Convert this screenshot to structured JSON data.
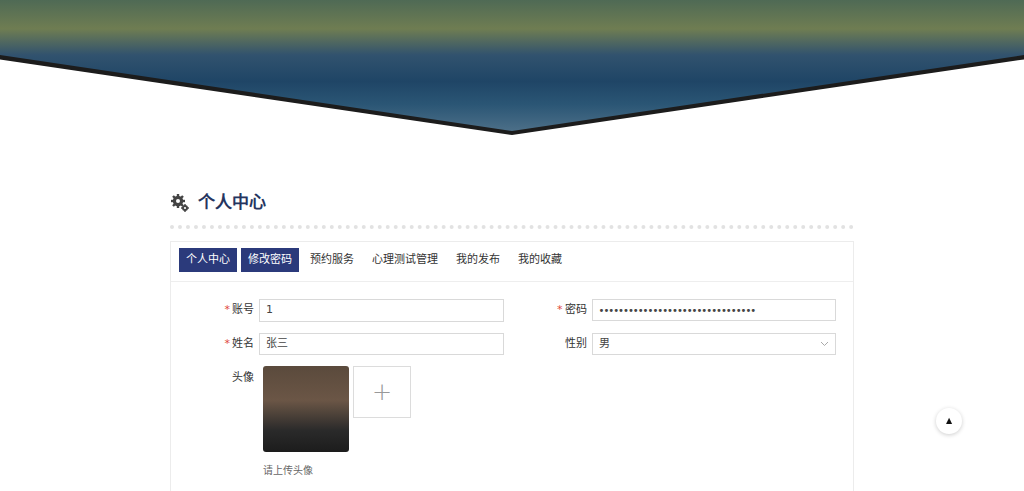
{
  "page": {
    "title": "个人中心"
  },
  "tabs": [
    {
      "label": "个人中心",
      "selected": true,
      "hovered": false
    },
    {
      "label": "修改密码",
      "selected": false,
      "hovered": true
    },
    {
      "label": "预约服务",
      "selected": false,
      "hovered": false
    },
    {
      "label": "心理测试管理",
      "selected": false,
      "hovered": false
    },
    {
      "label": "我的发布",
      "selected": false,
      "hovered": false
    },
    {
      "label": "我的收藏",
      "selected": false,
      "hovered": false
    }
  ],
  "form": {
    "required_mark": "*",
    "fields": [
      {
        "label": "账号",
        "required": true,
        "value": "1",
        "kind": "text"
      },
      {
        "label": "密码",
        "required": true,
        "value": "••••••••••••••••••••••••••••••••",
        "kind": "password"
      },
      {
        "label": "姓名",
        "required": true,
        "value": "张三",
        "kind": "text"
      },
      {
        "label": "性别",
        "required": false,
        "value": "男",
        "kind": "select"
      }
    ],
    "avatar": {
      "label": "头像",
      "upload_icon": "+",
      "hint": "请上传头像"
    }
  },
  "scroll_top": {
    "icon": "▲"
  }
}
